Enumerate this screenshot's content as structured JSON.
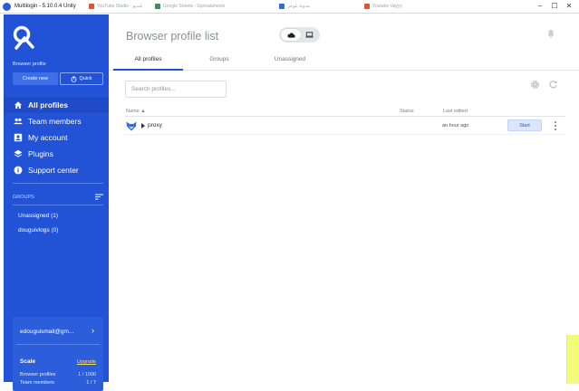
{
  "window": {
    "title": "Multilogin - 5.10.0.4 Unity",
    "background_tabs": [
      {
        "label": "YouTube Studio - فيديو",
        "color": "#e0533b"
      },
      {
        "label": "Google Sheets - Spreadsheets",
        "color": "#3c8f5a"
      },
      {
        "label": "مدونة بلوجر",
        "color": "#2d6fd6"
      },
      {
        "label": "Youtube Vayyy",
        "color": "#e0533b"
      }
    ]
  },
  "sidebar": {
    "browser_profile_label": "Browser profile",
    "create_new_label": "Create new",
    "quick_label": "Quick",
    "nav": [
      {
        "label": "All profiles",
        "icon": "home-icon",
        "active": true
      },
      {
        "label": "Team members",
        "icon": "team-icon",
        "active": false
      },
      {
        "label": "My account",
        "icon": "account-icon",
        "active": false
      },
      {
        "label": "Plugins",
        "icon": "layers-icon",
        "active": false
      },
      {
        "label": "Support center",
        "icon": "info-icon",
        "active": false
      }
    ],
    "groups_label": "GROUPS",
    "groups": [
      {
        "label": "Unassigned (1)"
      },
      {
        "label": "douguivlogs (0)"
      }
    ],
    "account": {
      "email": "edouguismall@gm...",
      "scale_label": "Scale",
      "upgrade_label": "Upgrade",
      "browser_profiles_label": "Browser profiles",
      "browser_profiles_value": "1 / 1000",
      "team_members_label": "Team members",
      "team_members_value": "1 / 7"
    }
  },
  "main": {
    "title": "Browser profile list",
    "tabs": [
      {
        "label": "All profiles",
        "active": true
      },
      {
        "label": "Groups",
        "active": false
      },
      {
        "label": "Unassigned",
        "active": false
      }
    ],
    "search_placeholder": "Search profiles...",
    "columns": {
      "name": "Name ▲",
      "status": "Status",
      "last_edited": "Last edited"
    },
    "rows": [
      {
        "name": "proxy",
        "status": "",
        "last_edited": "an hour ago",
        "action": "Start"
      }
    ]
  },
  "colors": {
    "sidebar": "#2253d6",
    "accent": "#2253d6",
    "upgrade": "#ffd95a"
  }
}
